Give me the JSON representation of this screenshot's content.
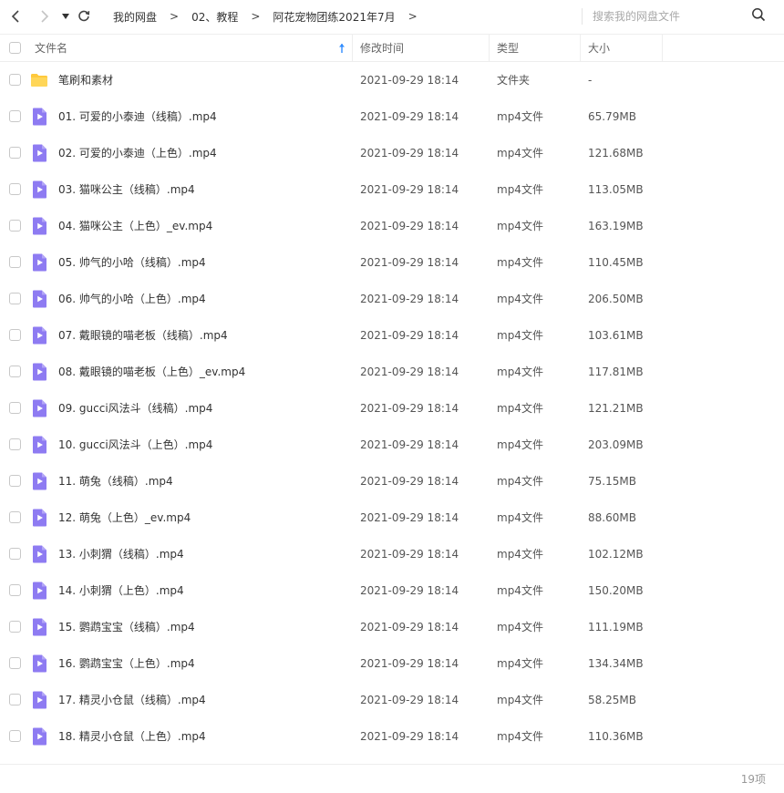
{
  "nav": {
    "back_icon": "chevron-left-icon",
    "forward_icon": "chevron-right-icon",
    "dropdown_icon": "caret-down-icon",
    "refresh_icon": "refresh-icon"
  },
  "breadcrumb": {
    "items": [
      "我的网盘",
      "02、教程",
      "阿花宠物团练2021年7月"
    ],
    "separator": ">"
  },
  "search": {
    "placeholder": "搜索我的网盘文件",
    "value": "",
    "icon": "search-icon"
  },
  "header": {
    "name": "文件名",
    "modified": "修改时间",
    "type": "类型",
    "size": "大小",
    "sort_icon": "sort-up-icon"
  },
  "colors": {
    "folder": "#ffc93c",
    "video": "#8e7bf2",
    "border": "#eeeeee",
    "sort_arrow": "#2f8cff"
  },
  "files": [
    {
      "icon": "folder-icon",
      "name": "笔刷和素材",
      "date": "2021-09-29 18:14",
      "type": "文件夹",
      "size": "-"
    },
    {
      "icon": "video-file-icon",
      "name": "01. 可爱的小泰迪（线稿）.mp4",
      "date": "2021-09-29 18:14",
      "type": "mp4文件",
      "size": "65.79MB"
    },
    {
      "icon": "video-file-icon",
      "name": "02. 可爱的小泰迪（上色）.mp4",
      "date": "2021-09-29 18:14",
      "type": "mp4文件",
      "size": "121.68MB"
    },
    {
      "icon": "video-file-icon",
      "name": "03. 猫咪公主（线稿）.mp4",
      "date": "2021-09-29 18:14",
      "type": "mp4文件",
      "size": "113.05MB"
    },
    {
      "icon": "video-file-icon",
      "name": "04. 猫咪公主（上色）_ev.mp4",
      "date": "2021-09-29 18:14",
      "type": "mp4文件",
      "size": "163.19MB"
    },
    {
      "icon": "video-file-icon",
      "name": "05. 帅气的小哈（线稿）.mp4",
      "date": "2021-09-29 18:14",
      "type": "mp4文件",
      "size": "110.45MB"
    },
    {
      "icon": "video-file-icon",
      "name": "06. 帅气的小哈（上色）.mp4",
      "date": "2021-09-29 18:14",
      "type": "mp4文件",
      "size": "206.50MB"
    },
    {
      "icon": "video-file-icon",
      "name": "07. 戴眼镜的喵老板（线稿）.mp4",
      "date": "2021-09-29 18:14",
      "type": "mp4文件",
      "size": "103.61MB"
    },
    {
      "icon": "video-file-icon",
      "name": "08. 戴眼镜的喵老板（上色）_ev.mp4",
      "date": "2021-09-29 18:14",
      "type": "mp4文件",
      "size": "117.81MB"
    },
    {
      "icon": "video-file-icon",
      "name": "09. gucci风法斗（线稿）.mp4",
      "date": "2021-09-29 18:14",
      "type": "mp4文件",
      "size": "121.21MB"
    },
    {
      "icon": "video-file-icon",
      "name": "10. gucci风法斗（上色）.mp4",
      "date": "2021-09-29 18:14",
      "type": "mp4文件",
      "size": "203.09MB"
    },
    {
      "icon": "video-file-icon",
      "name": "11. 萌兔（线稿）.mp4",
      "date": "2021-09-29 18:14",
      "type": "mp4文件",
      "size": "75.15MB"
    },
    {
      "icon": "video-file-icon",
      "name": "12. 萌兔（上色）_ev.mp4",
      "date": "2021-09-29 18:14",
      "type": "mp4文件",
      "size": "88.60MB"
    },
    {
      "icon": "video-file-icon",
      "name": "13. 小刺猬（线稿）.mp4",
      "date": "2021-09-29 18:14",
      "type": "mp4文件",
      "size": "102.12MB"
    },
    {
      "icon": "video-file-icon",
      "name": "14. 小刺猬（上色）.mp4",
      "date": "2021-09-29 18:14",
      "type": "mp4文件",
      "size": "150.20MB"
    },
    {
      "icon": "video-file-icon",
      "name": "15. 鹦鹉宝宝（线稿）.mp4",
      "date": "2021-09-29 18:14",
      "type": "mp4文件",
      "size": "111.19MB"
    },
    {
      "icon": "video-file-icon",
      "name": "16. 鹦鹉宝宝（上色）.mp4",
      "date": "2021-09-29 18:14",
      "type": "mp4文件",
      "size": "134.34MB"
    },
    {
      "icon": "video-file-icon",
      "name": "17. 精灵小仓鼠（线稿）.mp4",
      "date": "2021-09-29 18:14",
      "type": "mp4文件",
      "size": "58.25MB"
    },
    {
      "icon": "video-file-icon",
      "name": "18. 精灵小仓鼠（上色）.mp4",
      "date": "2021-09-29 18:14",
      "type": "mp4文件",
      "size": "110.36MB"
    }
  ],
  "footer": {
    "count": "19项"
  }
}
